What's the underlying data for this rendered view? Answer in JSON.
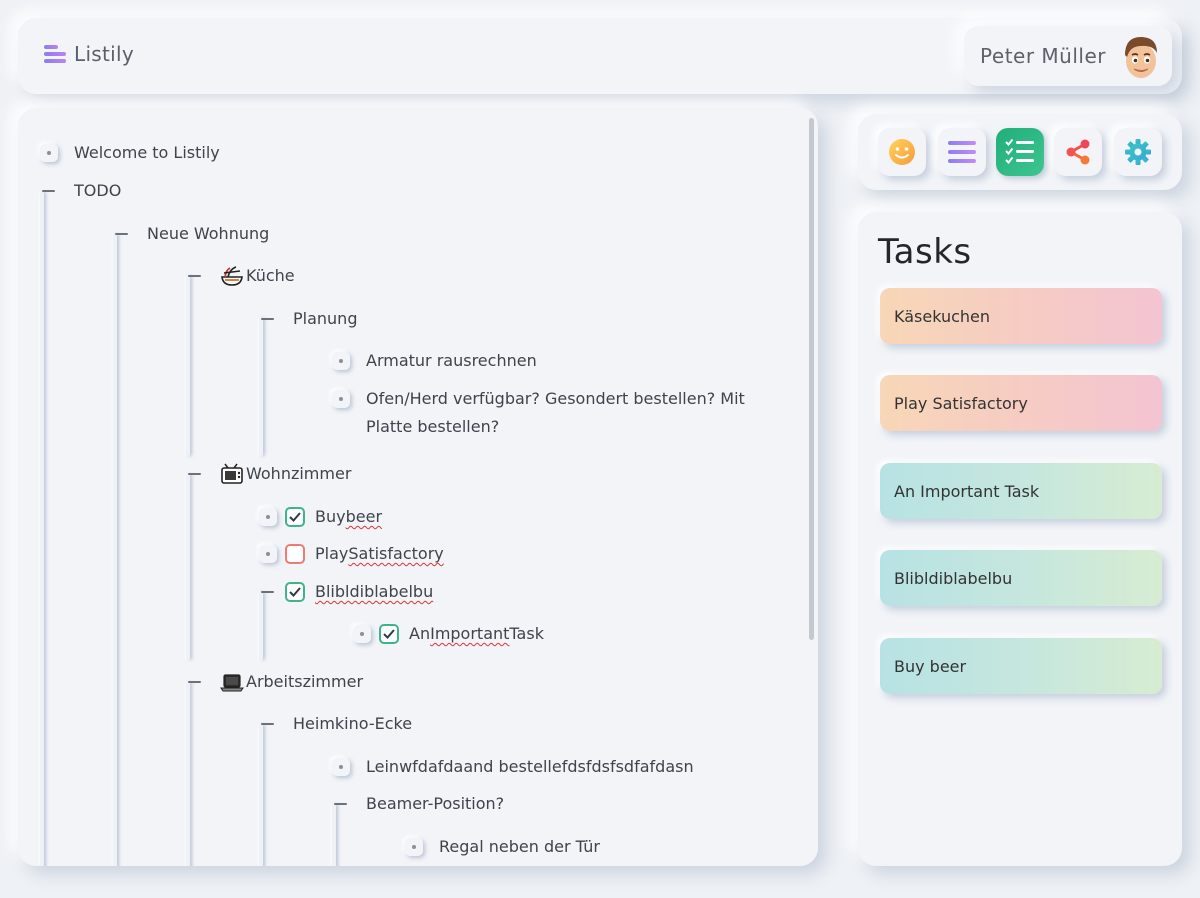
{
  "header": {
    "app_name": "Listily",
    "user_name": "Peter Müller",
    "logo_icon": "list-lines-icon",
    "avatar_icon": "memoji-avatar"
  },
  "tree": [
    {
      "id": "welcome",
      "label": "Welcome to Listily",
      "type": "leaf"
    },
    {
      "id": "todo",
      "label": "TODO",
      "type": "expanded"
    },
    {
      "id": "neue-wohnung",
      "label": "Neue Wohnung",
      "type": "expanded"
    },
    {
      "id": "kueche",
      "label": "Küche",
      "type": "expanded",
      "icon": "noodle-bowl-icon"
    },
    {
      "id": "planung",
      "label": "Planung",
      "type": "expanded"
    },
    {
      "id": "armatur",
      "label": "Armatur rausrechnen",
      "type": "leaf"
    },
    {
      "id": "ofen",
      "label": "Ofen/Herd verfügbar? Gesondert bestellen? Mit Platte bestellen?",
      "type": "leaf"
    },
    {
      "id": "wohnzimmer",
      "label": "Wohnzimmer",
      "type": "expanded",
      "icon": "tv-icon"
    },
    {
      "id": "buy-beer",
      "label_a": "Buy ",
      "label_b": "beer",
      "type": "leaf",
      "checked": true
    },
    {
      "id": "play-satisfactory",
      "label_a": "Play ",
      "label_b": "Satisfactory",
      "type": "leaf",
      "checked": false
    },
    {
      "id": "blibl",
      "label_b": "Blibldiblabelbu",
      "type": "expanded",
      "checked": true
    },
    {
      "id": "important",
      "label_a": "An ",
      "label_b": "Important",
      "label_c": " Task",
      "type": "leaf",
      "checked": true
    },
    {
      "id": "arbeitszimmer",
      "label": "Arbeitszimmer",
      "type": "expanded",
      "icon": "laptop-icon"
    },
    {
      "id": "heimkino",
      "label": "Heimkino-Ecke",
      "type": "expanded"
    },
    {
      "id": "leinwand",
      "label": "Leinwfdafdaand bestellefdsfdsfsdfafdasn",
      "type": "leaf"
    },
    {
      "id": "beamer",
      "label": "Beamer-Position?",
      "type": "expanded"
    },
    {
      "id": "regal",
      "label": "Regal neben der Tür",
      "type": "leaf"
    }
  ],
  "toolbar": {
    "tools": [
      {
        "name": "emoji-tool",
        "icon": "smiley-icon"
      },
      {
        "name": "list-tool",
        "icon": "list-lines-icon"
      },
      {
        "name": "tasks-tool",
        "icon": "checklist-icon",
        "active": true
      },
      {
        "name": "share-tool",
        "icon": "share-icon"
      },
      {
        "name": "settings-tool",
        "icon": "gear-icon"
      }
    ],
    "active_color": "#1fae7a"
  },
  "tasks": {
    "title": "Tasks",
    "items": [
      {
        "label": "Käsekuchen",
        "style": "warm"
      },
      {
        "label": "Play Satisfactory",
        "style": "warm"
      },
      {
        "label": "An Important Task",
        "style": "cool"
      },
      {
        "label": "Blibldiblabelbu",
        "style": "cool"
      },
      {
        "label": "Buy beer",
        "style": "cool"
      }
    ]
  }
}
